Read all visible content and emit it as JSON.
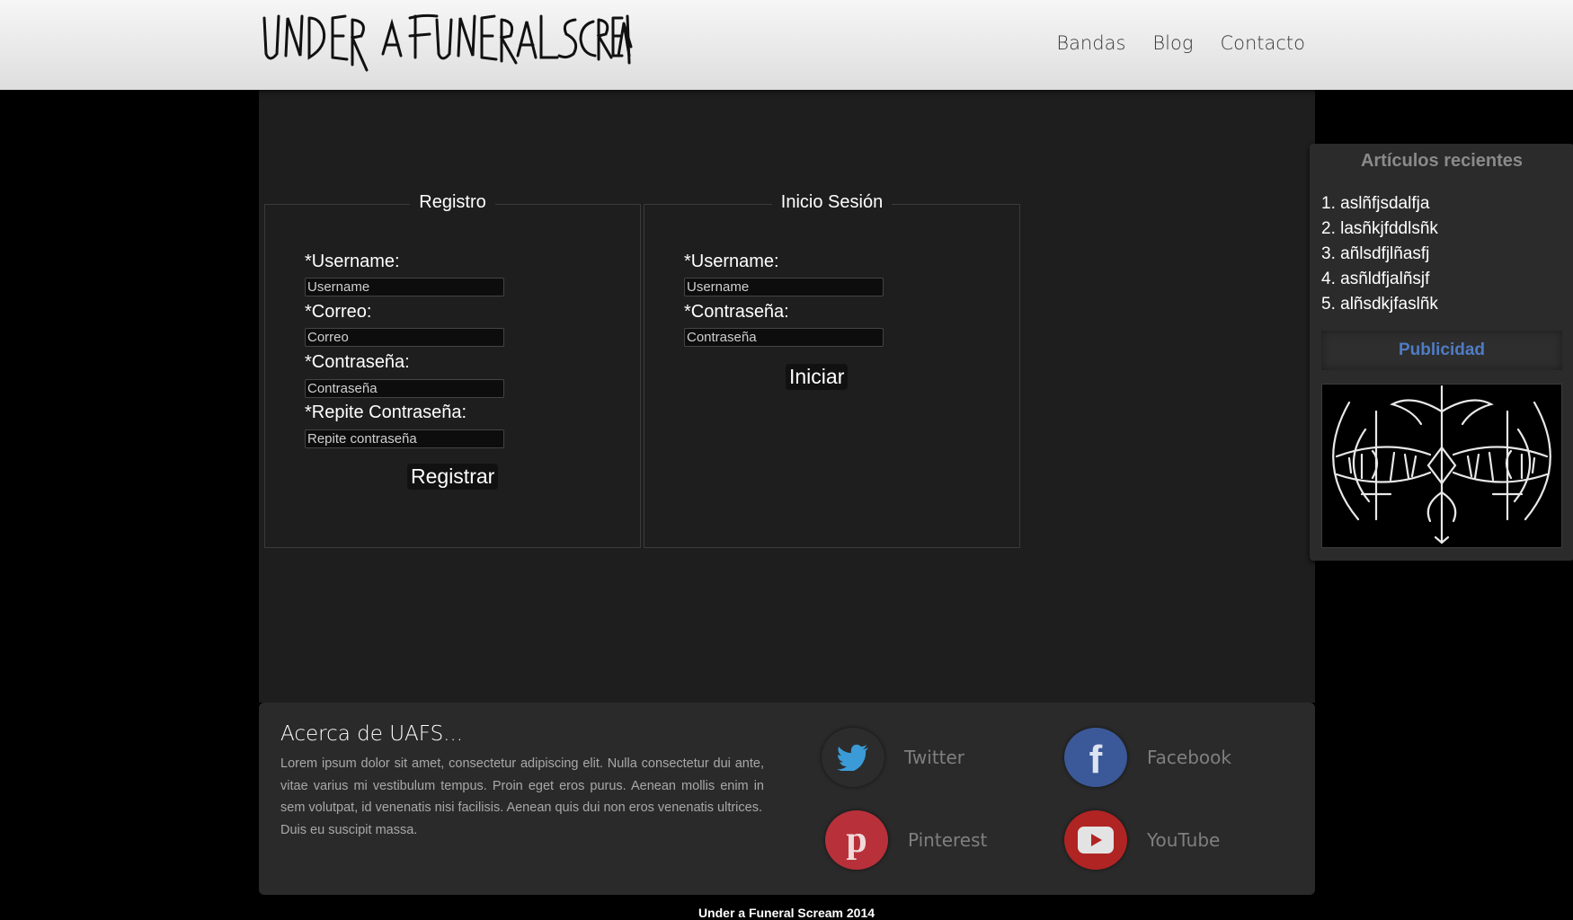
{
  "header": {
    "logo_text": "UNDER A FUNERAL SCREAM",
    "nav": [
      {
        "label": "Bandas"
      },
      {
        "label": "Blog"
      },
      {
        "label": "Contacto"
      }
    ]
  },
  "sidebar": {
    "title": "Artículos recientes",
    "recent": [
      "1. aslñfjsdalfja",
      "2. lasñkjfddlsñk",
      "3. añlsdfjlñasfj",
      "4. asñldfjalñsjf",
      "5. alñsdkjfaslñk"
    ],
    "ad_title": "Publicidad",
    "ad_image": "band-logo-icon"
  },
  "registro": {
    "legend": "Registro",
    "username_label": "*Username:",
    "username_placeholder": "Username",
    "correo_label": "*Correo:",
    "correo_placeholder": "Correo",
    "password_label": "*Contraseña:",
    "password_placeholder": "Contraseña",
    "repeat_label": "*Repite Contraseña:",
    "repeat_placeholder": "Repite contraseña",
    "submit": "Registrar"
  },
  "login": {
    "legend": "Inicio Sesión",
    "username_label": "*Username:",
    "username_placeholder": "Username",
    "password_label": "*Contraseña:",
    "password_placeholder": "Contraseña",
    "submit": "Iniciar"
  },
  "footer": {
    "about_title": "Acerca de UAFS...",
    "about_p1": "Lorem ipsum dolor sit amet, consectetur adipiscing elit. Nulla consectetur dui ante, vitae varius mi vestibulum tempus. Proin eget eros purus. Aenean mollis enim in sem volutpat, id venenatis nisi facilisis. Aenean quis dui non eros venenatis ultrices.",
    "about_p2": "Duis eu suscipit massa.",
    "social": [
      {
        "label": "Twitter",
        "icon": "twitter-icon",
        "color": "#2c2c2c",
        "glyph_color": "#3a9bd6"
      },
      {
        "label": "Facebook",
        "icon": "facebook-icon",
        "color": "#3b5998"
      },
      {
        "label": "Pinterest",
        "icon": "pinterest-icon",
        "color": "#b8313a"
      },
      {
        "label": "YouTube",
        "icon": "youtube-icon",
        "color": "#b02424"
      }
    ],
    "copyright": "Under a Funeral Scream 2014"
  },
  "colors": {
    "accent_blue": "#4f7cc4",
    "panel_bg": "#1e1e1e",
    "footer_bg": "#2a2a2a"
  }
}
